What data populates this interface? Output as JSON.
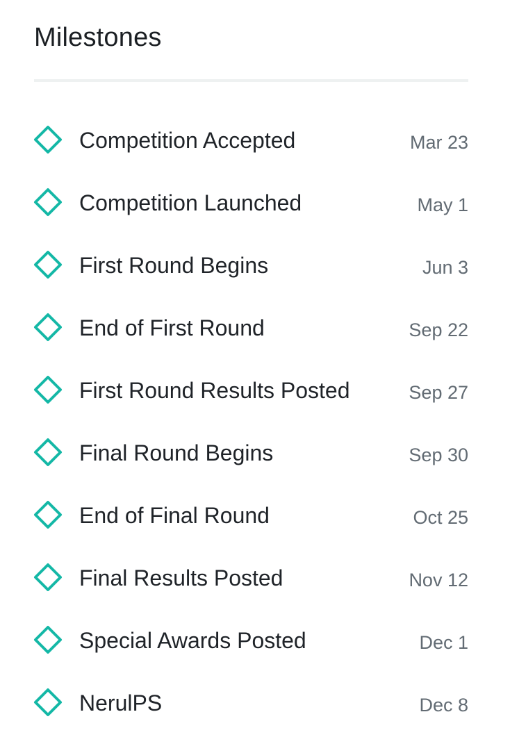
{
  "header": {
    "title": "Milestones"
  },
  "icon": {
    "name": "diamond-outline-icon",
    "color": "#14b8a6"
  },
  "milestones": [
    {
      "label": "Competition Accepted",
      "date": "Mar 23"
    },
    {
      "label": "Competition Launched",
      "date": "May 1"
    },
    {
      "label": "First Round Begins",
      "date": "Jun 3"
    },
    {
      "label": "End of First Round",
      "date": "Sep 22"
    },
    {
      "label": "First Round Results Posted",
      "date": "Sep 27"
    },
    {
      "label": "Final Round Begins",
      "date": "Sep 30"
    },
    {
      "label": "End of Final Round",
      "date": "Oct 25"
    },
    {
      "label": "Final Results Posted",
      "date": "Nov 12"
    },
    {
      "label": "Special Awards Posted",
      "date": "Dec 1"
    },
    {
      "label": "NerulPS",
      "date": "Dec 8"
    }
  ]
}
